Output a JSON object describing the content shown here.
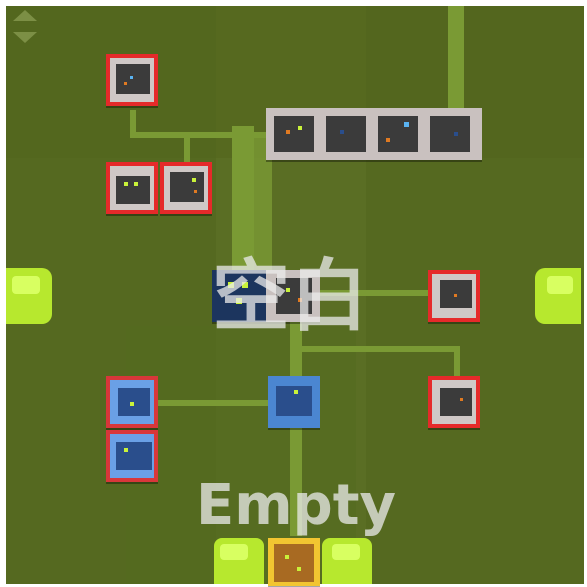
{
  "overlay": {
    "center_label": "空白",
    "bottom_label": "Empty"
  },
  "controls": {
    "scroll_icon": "up-down-arrows-icon"
  },
  "colors": {
    "field": "#5a6e24",
    "path": "#7a9a34",
    "door": "#b7e82e",
    "locked_frame": "#e52a2a",
    "open_frame": "#4b86d1",
    "selected_frame": "#f2c531"
  }
}
